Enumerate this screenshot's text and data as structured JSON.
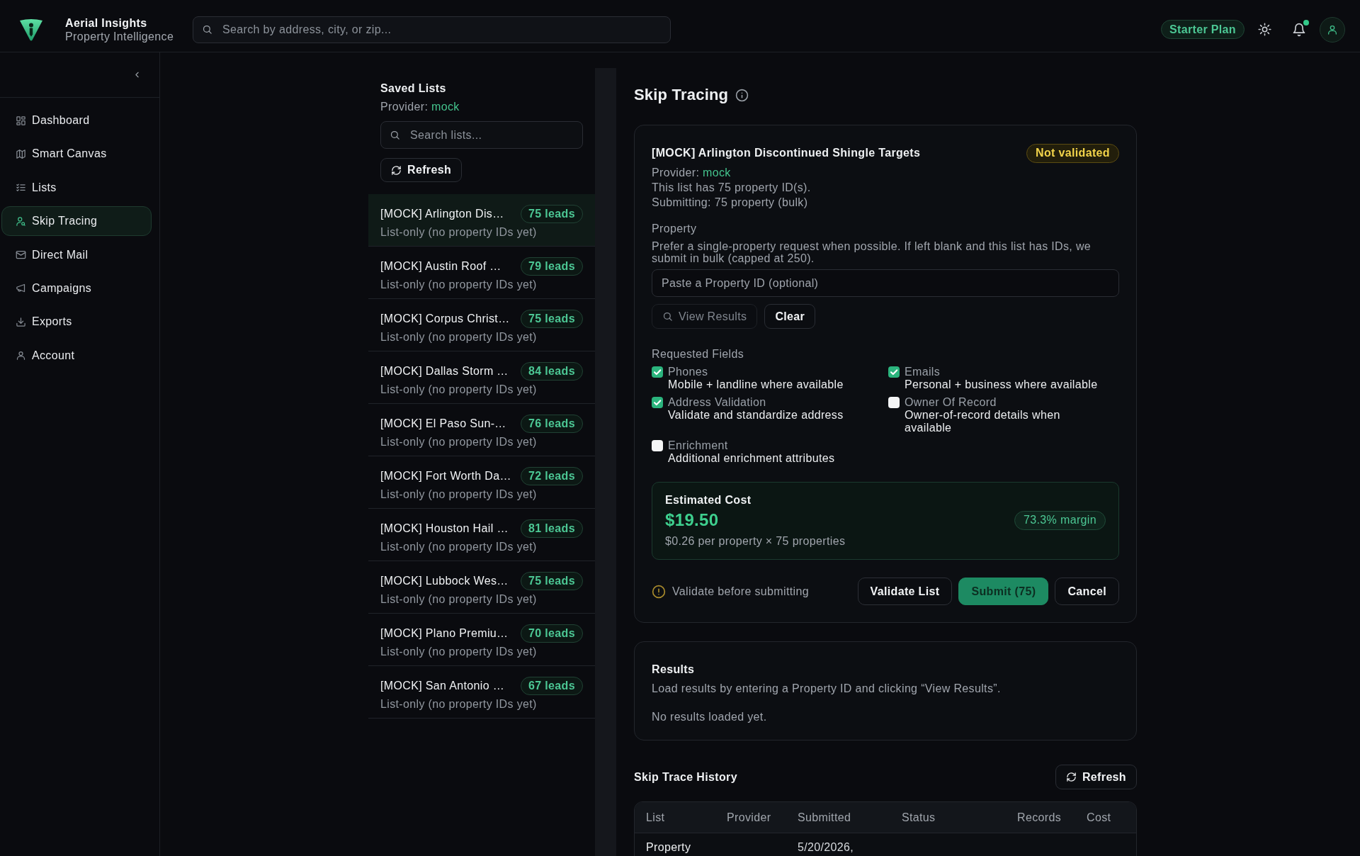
{
  "app": {
    "name": "Aerial Insights",
    "tagline": "Property Intelligence"
  },
  "search": {
    "placeholder": "Search by address, city, or zip..."
  },
  "header": {
    "plan": "Starter Plan",
    "unread_notifications": true
  },
  "sidebar": {
    "items": [
      {
        "label": "Dashboard",
        "selected": false
      },
      {
        "label": "Smart Canvas",
        "selected": false
      },
      {
        "label": "Lists",
        "selected": false
      },
      {
        "label": "Skip Tracing",
        "selected": true
      },
      {
        "label": "Direct Mail",
        "selected": false
      },
      {
        "label": "Campaigns",
        "selected": false
      },
      {
        "label": "Exports",
        "selected": false
      },
      {
        "label": "Account",
        "selected": false
      }
    ]
  },
  "saved_lists": {
    "title": "Saved Lists",
    "provider_label": "Provider:",
    "provider": "mock",
    "search_placeholder": "Search lists...",
    "refresh": "Refresh",
    "items": [
      {
        "name": "[MOCK] Arlington Dis…",
        "leads": "75 leads",
        "note": "List-only (no property IDs yet)",
        "selected": true
      },
      {
        "name": "[MOCK] Austin Roof …",
        "leads": "79 leads",
        "note": "List-only (no property IDs yet)",
        "selected": false
      },
      {
        "name": "[MOCK] Corpus Christ…",
        "leads": "75 leads",
        "note": "List-only (no property IDs yet)",
        "selected": false
      },
      {
        "name": "[MOCK] Dallas Storm …",
        "leads": "84 leads",
        "note": "List-only (no property IDs yet)",
        "selected": false
      },
      {
        "name": "[MOCK] El Paso Sun-…",
        "leads": "76 leads",
        "note": "List-only (no property IDs yet)",
        "selected": false
      },
      {
        "name": "[MOCK] Fort Worth Da…",
        "leads": "72 leads",
        "note": "List-only (no property IDs yet)",
        "selected": false
      },
      {
        "name": "[MOCK] Houston Hail …",
        "leads": "81 leads",
        "note": "List-only (no property IDs yet)",
        "selected": false
      },
      {
        "name": "[MOCK] Lubbock Wes…",
        "leads": "75 leads",
        "note": "List-only (no property IDs yet)",
        "selected": false
      },
      {
        "name": "[MOCK] Plano Premiu…",
        "leads": "70 leads",
        "note": "List-only (no property IDs yet)",
        "selected": false
      },
      {
        "name": "[MOCK] San Antonio …",
        "leads": "67 leads",
        "note": "List-only (no property IDs yet)",
        "selected": false
      }
    ]
  },
  "skip_tracing": {
    "title": "Skip Tracing",
    "list_name": "[MOCK] Arlington Discontinued Shingle Targets",
    "validation": {
      "label": "Not validated",
      "validated": false
    },
    "provider_label": "Provider:",
    "provider": "mock",
    "details": [
      "This list has 75 property ID(s).",
      "Submitting: 75 property (bulk)"
    ],
    "property": {
      "label": "Property",
      "help": "Prefer a single-property request when possible. If left blank and this list has IDs, we submit in bulk (capped at 250).",
      "placeholder": "Paste a Property ID (optional)"
    },
    "property_actions": [
      {
        "label": "View Results",
        "kind": "search",
        "disabled": true
      },
      {
        "label": "Clear",
        "kind": "plain",
        "disabled": false
      }
    ],
    "requested_fields": {
      "title": "Requested Fields",
      "items": [
        {
          "label": "Phones",
          "description": "Mobile + landline where available",
          "checked": true
        },
        {
          "label": "Emails",
          "description": "Personal + business where available",
          "checked": true
        },
        {
          "label": "Address Validation",
          "description": "Validate and standardize address",
          "checked": true
        },
        {
          "label": "Owner Of Record",
          "description": "Owner-of-record details when available",
          "checked": false
        },
        {
          "label": "Enrichment",
          "description": "Additional enrichment attributes",
          "checked": false
        }
      ]
    },
    "estimate": {
      "title": "Estimated Cost",
      "amount": "$19.50",
      "margin": "73.3% margin",
      "detail": "$0.26 per property × 75 properties"
    },
    "notice": "Validate before submitting",
    "actions": [
      {
        "label": "Validate List",
        "kind": "secondary"
      },
      {
        "label": "Submit (75)",
        "kind": "primary"
      },
      {
        "label": "Cancel",
        "kind": "secondary"
      }
    ]
  },
  "results": {
    "title": "Results",
    "hint": "Load results by entering a Property ID and clicking “View Results”.",
    "empty": "No results loaded yet."
  },
  "history": {
    "title": "Skip Trace History",
    "refresh": "Refresh",
    "table": {
      "columns": [
        "List",
        "Provider",
        "Submitted",
        "Status",
        "Records",
        "Cost"
      ],
      "rows": [
        {
          "list": "Property",
          "submitted": "5/20/2026,"
        }
      ]
    }
  }
}
